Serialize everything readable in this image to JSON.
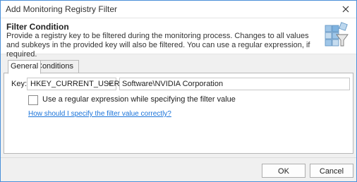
{
  "window": {
    "title": "Add Monitoring Registry Filter"
  },
  "header": {
    "title": "Filter Condition",
    "description": "Provide a registry key to be filtered during the monitoring process. Changes to all values and subkeys in the provided key will also be filtered. You can use a regular expression, if required.",
    "icon": "registry-filter-icon"
  },
  "tabs": [
    {
      "label": "General",
      "active": true
    },
    {
      "label": "Conditions",
      "active": false
    }
  ],
  "general": {
    "key_label": "Key:",
    "hive_value": "HKEY_CURRENT_USER",
    "key_value": "Software\\NVIDIA Corporation",
    "regex_checkbox_label": "Use a regular expression while specifying the filter value",
    "regex_checked": false,
    "help_link": "How should I specify the filter value correctly?"
  },
  "footer": {
    "ok_label": "OK",
    "cancel_label": "Cancel"
  },
  "colors": {
    "accent": "#4a90d9",
    "link": "#1a73d9"
  }
}
